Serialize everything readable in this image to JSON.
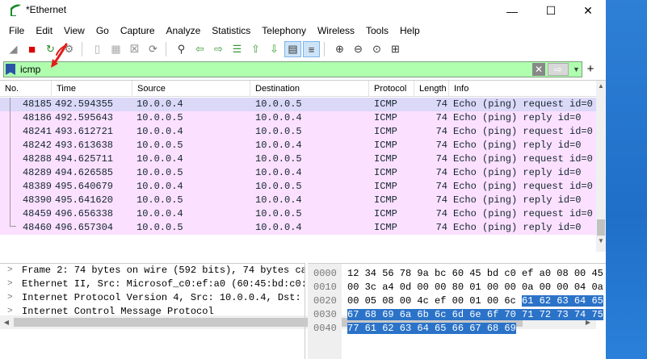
{
  "window": {
    "title": "*Ethernet",
    "min_glyph": "—",
    "max_glyph": "☐",
    "close_glyph": "✕"
  },
  "menu": [
    "File",
    "Edit",
    "View",
    "Go",
    "Capture",
    "Analyze",
    "Statistics",
    "Telephony",
    "Wireless",
    "Tools",
    "Help"
  ],
  "toolbar": {
    "icons": [
      {
        "name": "start-capture-icon",
        "glyph": "◢"
      },
      {
        "name": "stop-capture-icon",
        "glyph": "■"
      },
      {
        "name": "restart-capture-icon",
        "glyph": "↻"
      },
      {
        "name": "capture-options-icon",
        "glyph": "⚙"
      },
      {
        "name": "open-file-icon",
        "glyph": "▯"
      },
      {
        "name": "save-file-icon",
        "glyph": "▦"
      },
      {
        "name": "close-file-icon",
        "glyph": "☒"
      },
      {
        "name": "reload-file-icon",
        "glyph": "⟳"
      },
      {
        "name": "find-packet-icon",
        "glyph": "⚲"
      },
      {
        "name": "go-back-icon",
        "glyph": "⇦"
      },
      {
        "name": "go-forward-icon",
        "glyph": "⇨"
      },
      {
        "name": "go-to-packet-icon",
        "glyph": "☰"
      },
      {
        "name": "first-packet-icon",
        "glyph": "⇧"
      },
      {
        "name": "last-packet-icon",
        "glyph": "⇩"
      },
      {
        "name": "autoscroll-icon",
        "glyph": "▤"
      },
      {
        "name": "colorize-icon",
        "glyph": "≡"
      },
      {
        "name": "zoom-in-icon",
        "glyph": "⊕"
      },
      {
        "name": "zoom-out-icon",
        "glyph": "⊖"
      },
      {
        "name": "normal-size-icon",
        "glyph": "⊙"
      },
      {
        "name": "resize-columns-icon",
        "glyph": "⊞"
      }
    ]
  },
  "filter": {
    "value": "icmp",
    "clear_glyph": "✕",
    "apply_glyph": "⇨",
    "dropdown_glyph": "▼",
    "add_glyph": "+"
  },
  "packet_list": {
    "columns": [
      "No.",
      "Time",
      "Source",
      "Destination",
      "Protocol",
      "Length",
      "Info"
    ],
    "rows": [
      {
        "no": "48185",
        "time": "492.594355",
        "src": "10.0.0.4",
        "dst": "10.0.0.5",
        "proto": "ICMP",
        "len": "74",
        "info": "Echo (ping) request  id=0",
        "selected": true
      },
      {
        "no": "48186",
        "time": "492.595643",
        "src": "10.0.0.5",
        "dst": "10.0.0.4",
        "proto": "ICMP",
        "len": "74",
        "info": "Echo (ping) reply    id=0"
      },
      {
        "no": "48241",
        "time": "493.612721",
        "src": "10.0.0.4",
        "dst": "10.0.0.5",
        "proto": "ICMP",
        "len": "74",
        "info": "Echo (ping) request  id=0"
      },
      {
        "no": "48242",
        "time": "493.613638",
        "src": "10.0.0.5",
        "dst": "10.0.0.4",
        "proto": "ICMP",
        "len": "74",
        "info": "Echo (ping) reply    id=0"
      },
      {
        "no": "48288",
        "time": "494.625711",
        "src": "10.0.0.4",
        "dst": "10.0.0.5",
        "proto": "ICMP",
        "len": "74",
        "info": "Echo (ping) request  id=0"
      },
      {
        "no": "48289",
        "time": "494.626585",
        "src": "10.0.0.5",
        "dst": "10.0.0.4",
        "proto": "ICMP",
        "len": "74",
        "info": "Echo (ping) reply    id=0"
      },
      {
        "no": "48389",
        "time": "495.640679",
        "src": "10.0.0.4",
        "dst": "10.0.0.5",
        "proto": "ICMP",
        "len": "74",
        "info": "Echo (ping) request  id=0"
      },
      {
        "no": "48390",
        "time": "495.641620",
        "src": "10.0.0.5",
        "dst": "10.0.0.4",
        "proto": "ICMP",
        "len": "74",
        "info": "Echo (ping) reply    id=0"
      },
      {
        "no": "48459",
        "time": "496.656338",
        "src": "10.0.0.4",
        "dst": "10.0.0.5",
        "proto": "ICMP",
        "len": "74",
        "info": "Echo (ping) request  id=0"
      },
      {
        "no": "48460",
        "time": "496.657304",
        "src": "10.0.0.5",
        "dst": "10.0.0.4",
        "proto": "ICMP",
        "len": "74",
        "info": "Echo (ping) reply    id=0"
      }
    ]
  },
  "details": [
    "Frame 2: 74 bytes on wire (592 bits), 74 bytes cap",
    "Ethernet II, Src: Microsof_c0:ef:a0 (60:45:bd:c0:e",
    "Internet Protocol Version 4, Src: 10.0.0.4, Dst: 1",
    "Internet Control Message Protocol"
  ],
  "bytes": [
    {
      "offset": "0000",
      "plain": "12 34 56 78 9a bc 60 45  bd c0 ef a0 08 00 45",
      "hl": ""
    },
    {
      "offset": "0010",
      "plain": "00 3c a4 0d 00 00 80 01  00 00 0a 00 00 04 0a",
      "hl": ""
    },
    {
      "offset": "0020",
      "plain": "00 05 08 00 4c ef 00 01  00 6c ",
      "hl": "61 62 63 64 65"
    },
    {
      "offset": "0030",
      "plain": "",
      "hl": "67 68 69 6a 6b 6c 6d 6e  6f 70 71 72 73 74 75"
    },
    {
      "offset": "0040",
      "plain": "",
      "hl": "77 61 62 63 64 65 66 67  68 69"
    }
  ],
  "scroll": {
    "up_glyph": "▲",
    "down_glyph": "▼",
    "left_glyph": "◀",
    "right_glyph": "▶"
  },
  "colors": {
    "filter_bg": "#afffaf",
    "icmp_row": "#fce0ff",
    "selected_row": "#dcd8f8",
    "byte_highlight": "#2b73c8"
  }
}
